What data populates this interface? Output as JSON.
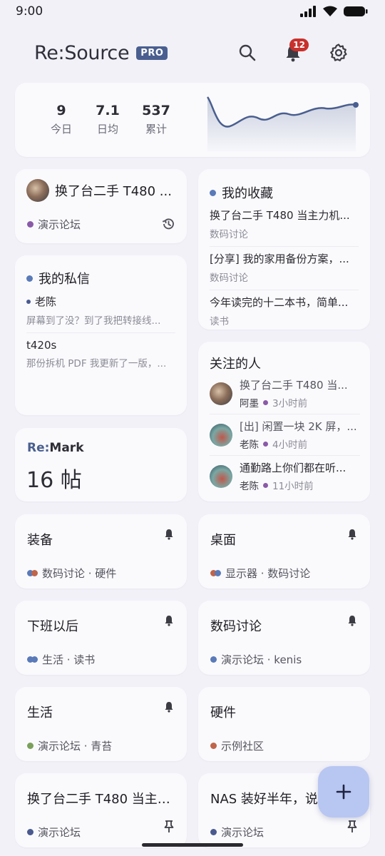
{
  "status_bar": {
    "time": "9:00"
  },
  "header": {
    "brand": "Re:Source",
    "badge": "PRO",
    "notification_count": "12"
  },
  "stats": {
    "items": [
      {
        "value": "9",
        "label": "今日"
      },
      {
        "value": "7.1",
        "label": "日均"
      },
      {
        "value": "537",
        "label": "累计"
      }
    ],
    "line_color": "#4a5f8f"
  },
  "recent_thread": {
    "title": "换了台二手 T480 ...",
    "forum": "演示论坛",
    "forum_color": "#8a5aa8"
  },
  "favorites": {
    "title": "我的收藏",
    "dot_color": "#5a7ab8",
    "items": [
      {
        "title": "换了台二手 T480 当主力机...",
        "forum": "数码讨论"
      },
      {
        "title": "[分享] 我的家用备份方案，...",
        "forum": "数码讨论"
      },
      {
        "title": "今年读完的十二本书，简单...",
        "forum": "读书"
      }
    ]
  },
  "messages": {
    "title": "我的私信",
    "dot_color": "#5a7ab8",
    "items": [
      {
        "name": "老陈",
        "preview": "屏幕到了没？到了我把转接线..."
      },
      {
        "name": "t420s",
        "preview": "那份拆机 PDF 我更新了一版，..."
      }
    ]
  },
  "following": {
    "title": "关注的人",
    "items": [
      {
        "title": "换了台二手 T480 当...",
        "author": "阿墨",
        "time": "3小时前"
      },
      {
        "title": "[出] 闲置一块 2K 屏，...",
        "author": "老陈",
        "time": "4小时前"
      },
      {
        "title": "通勤路上你们都在听...",
        "author": "老陈",
        "time": "11小时前"
      }
    ],
    "time_dot_color": "#8a5aa8"
  },
  "remark": {
    "brand_a": "Re:",
    "brand_b": "Mark",
    "count": "16 帖"
  },
  "subscriptions": [
    {
      "title": "装备",
      "meta": "数码讨论 · 硬件",
      "colors": [
        "#5a7ab8",
        "#c0644a"
      ],
      "bell": true
    },
    {
      "title": "桌面",
      "meta": "显示器 · 数码讨论",
      "colors": [
        "#c0644a",
        "#5a7ab8"
      ],
      "bell": true
    },
    {
      "title": "下班以后",
      "meta": "生活 · 读书",
      "colors": [
        "#5a7ab8",
        "#5a7ab8"
      ],
      "bell": true
    },
    {
      "title": "数码讨论",
      "meta": "演示论坛 · kenis",
      "colors": [
        "#5a7ab8"
      ],
      "bell": true
    },
    {
      "title": "生活",
      "meta": "演示论坛 · 青苔",
      "colors": [
        "#7aa05a"
      ],
      "bell": true
    },
    {
      "title": "硬件",
      "meta": "示例社区",
      "colors": [
        "#c0644a"
      ],
      "bell": false
    },
    {
      "title": "换了台二手 T480 当主力...",
      "meta": "演示论坛",
      "colors": [
        "#4a5a8f"
      ],
      "pin": true
    },
    {
      "title": "NAS 装好半年，说",
      "meta": "演示论坛",
      "colors": [
        "#4a5a8f"
      ],
      "pin": true
    }
  ],
  "fab": {
    "icon": "plus-icon"
  }
}
